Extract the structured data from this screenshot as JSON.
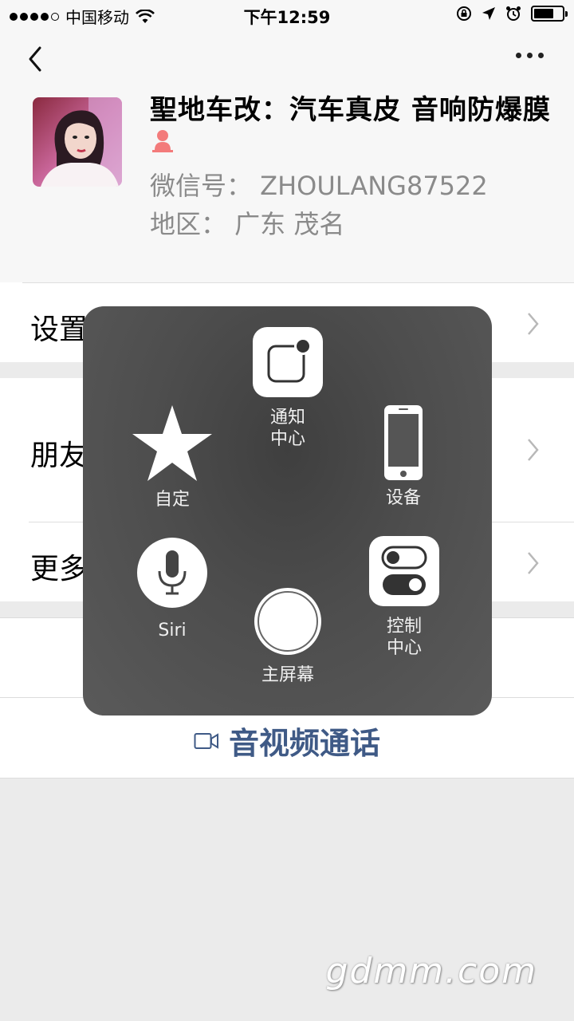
{
  "status_bar": {
    "carrier": "中国移动",
    "time": "下午12:59",
    "battery_level": 0.7
  },
  "nav": {
    "back_icon": "chevron-left-icon",
    "more_icon": "more-dots-icon"
  },
  "profile": {
    "name": "聖地车改：汽车真皮 音响防爆膜",
    "wechat_id": "微信号：  ZHOULANG87522",
    "region": "地区：  广东 茂名",
    "gender_icon": "female-icon",
    "gender_color": "#f37b7b"
  },
  "rows": [
    {
      "label": "设置"
    },
    {
      "label": "朋友"
    },
    {
      "label": "更多"
    }
  ],
  "call": {
    "label": "音视频通话",
    "icon": "video-camera-icon",
    "color": "#3f5a86"
  },
  "assistive_touch": {
    "notification_center": "通知\n中心",
    "customize": "自定",
    "device": "设备",
    "siri": "Siri",
    "home": "主屏幕",
    "control_center": "控制\n中心"
  },
  "watermark": "gdmm.com"
}
